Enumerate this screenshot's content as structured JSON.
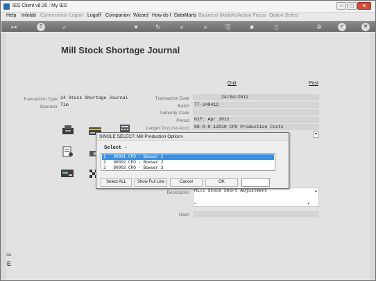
{
  "window": {
    "title": "IES Client v8.35 : My IES"
  },
  "menu": [
    {
      "label": "Help",
      "dim": false
    },
    {
      "label": "Infolab",
      "dim": false
    },
    {
      "label": "Connections",
      "dim": true
    },
    {
      "label": "Logon",
      "dim": true
    },
    {
      "label": "Logoff",
      "dim": false
    },
    {
      "label": "Companion",
      "dim": false
    },
    {
      "label": "Wizard",
      "dim": false
    },
    {
      "label": "How do I",
      "dim": false
    },
    {
      "label": "DataMarts",
      "dim": false
    },
    {
      "label": "Business Modules",
      "dim": true
    },
    {
      "label": "Action Focus",
      "dim": true
    },
    {
      "label": "Option Select",
      "dim": true
    }
  ],
  "page": {
    "title": "Mill Stock Shortage Journal",
    "quit_label": "Quit",
    "post_label": "Post"
  },
  "form": {
    "transaction_type_label": "Transaction Type",
    "transaction_type_value": "24 Stock Shortage Journal",
    "operator_label": "Operator",
    "operator_value": "Tim",
    "transaction_date_label": "Transaction Date",
    "transaction_date_value": "24/04/2012",
    "batch_label": "Batch",
    "batch_value": "TT-240412",
    "authority_code_label": "Authority Code",
    "authority_code_value": "",
    "period_label": "Period",
    "period_value": "017: Apr 2012",
    "ledger_label": "Ledger Dt (Loss Acct)",
    "ledger_value": "99-0-0-12010 CPO Production Costs",
    "description_label": "Description",
    "description_value": "Mill Stock Short Adjustment",
    "hash_label": "Hash",
    "hash_value": ""
  },
  "dialog": {
    "title": "SINGLE SELECT: Mill Production Options",
    "select_label": "Select -",
    "options": [
      "1   90001 CPO - Bowser 1",
      "2   90002 CPO - Bowser 2",
      "3   90003 CPO - Bowser 3"
    ],
    "selected_index": 0,
    "select_all_label": "Select ALL",
    "show_full_line_label": "Show Full Line",
    "cancel_label": "Cancel",
    "ok_label": "OK"
  },
  "sidebar": {
    "small_label": "Se"
  }
}
